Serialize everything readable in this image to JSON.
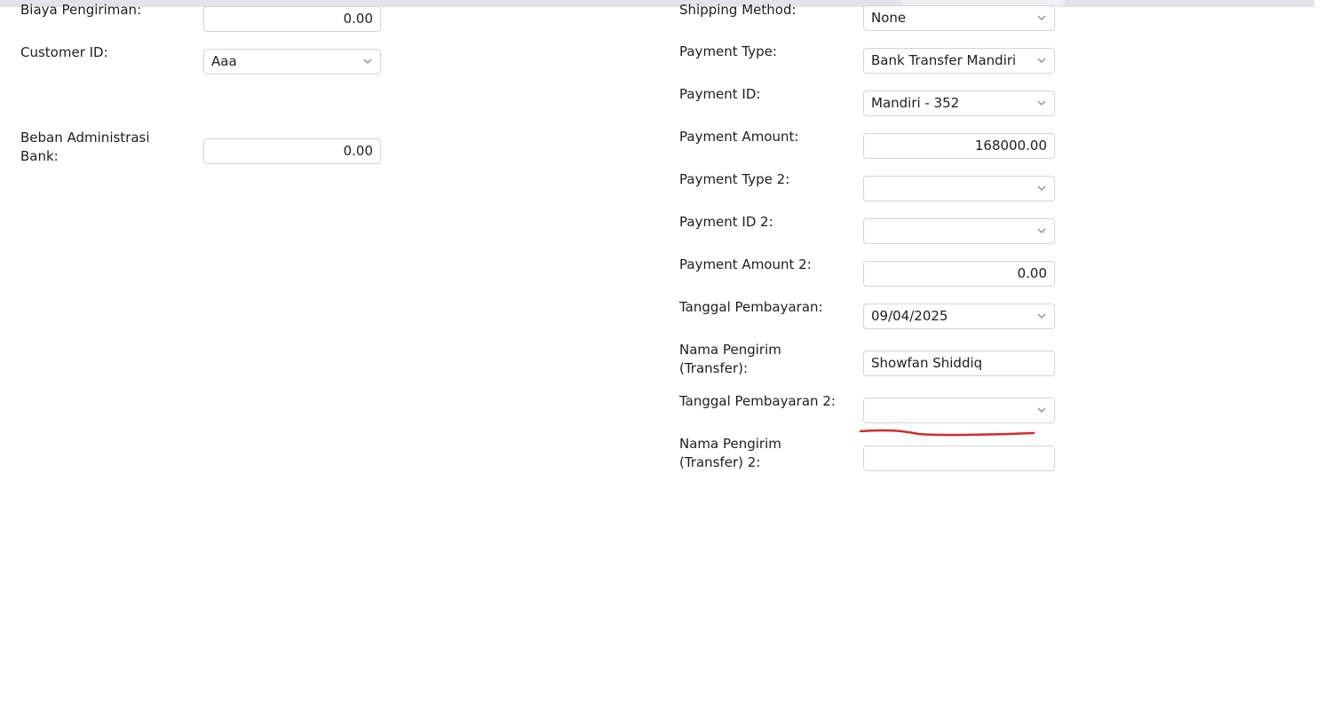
{
  "left_form": {
    "biaya_pengiriman": {
      "label": "Biaya Pengiriman:",
      "value": "0.00"
    },
    "customer_id": {
      "label": "Customer ID:",
      "value": "Aaa"
    },
    "beban_admin": {
      "label_line1": "Beban Administrasi",
      "label_line2": "Bank:",
      "value": "0.00"
    }
  },
  "right_form": {
    "shipping_method": {
      "label": "Shipping Method:",
      "value": "None"
    },
    "payment_type": {
      "label": "Payment Type:",
      "value": "Bank Transfer Mandiri"
    },
    "payment_id": {
      "label": "Payment ID:",
      "value": "Mandiri - 352"
    },
    "payment_amount": {
      "label": "Payment Amount:",
      "value": "168000.00"
    },
    "payment_type_2": {
      "label": "Payment Type 2:",
      "value": ""
    },
    "payment_id_2": {
      "label": "Payment ID 2:",
      "value": ""
    },
    "payment_amount_2": {
      "label": "Payment Amount 2:",
      "value": "0.00"
    },
    "tanggal_pembayaran": {
      "label": "Tanggal Pembayaran:",
      "value": "09/04/2025"
    },
    "nama_pengirim": {
      "label_line1": "Nama Pengirim",
      "label_line2": "(Transfer):",
      "value": "Showfan Shiddiq"
    },
    "tanggal_pembayaran_2": {
      "label": "Tanggal Pembayaran 2:",
      "value": ""
    },
    "nama_pengirim_2": {
      "label_line1": "Nama Pengirim",
      "label_line2": "(Transfer) 2:",
      "value": ""
    }
  },
  "icons": {
    "dropdown": "chevron-down-icon"
  },
  "colors": {
    "annotation": "#d42a2a",
    "border": "#d4d4d8",
    "top_bar": "#e3e3ec"
  }
}
